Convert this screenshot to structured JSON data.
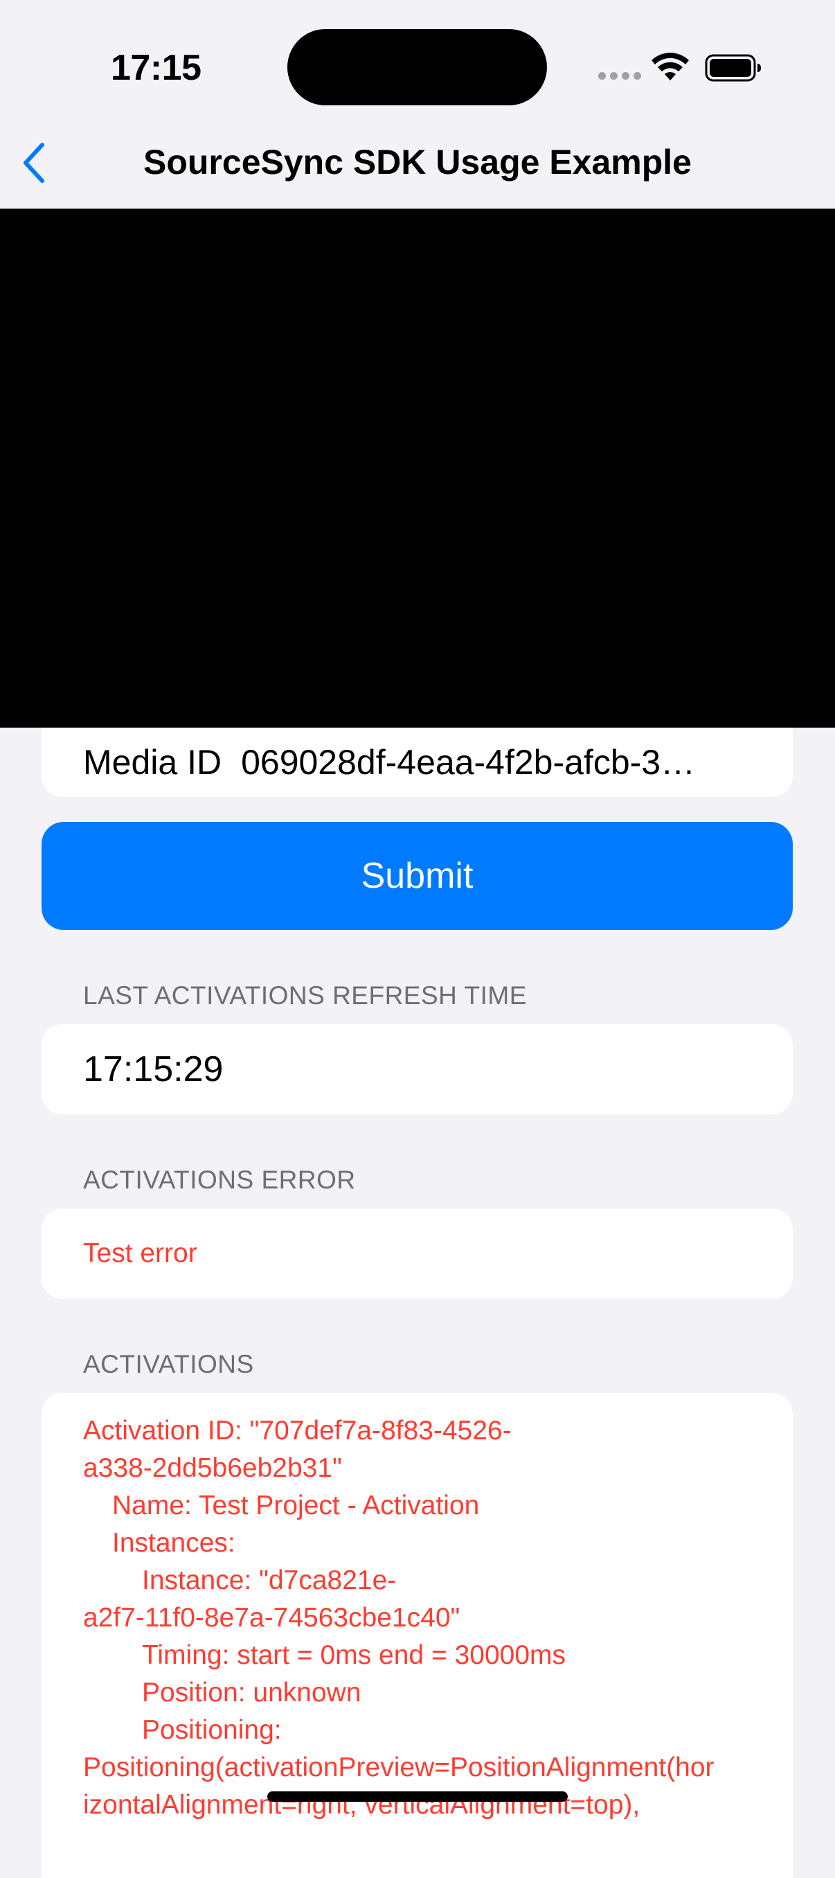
{
  "status_bar": {
    "time": "17:15",
    "icons": [
      "cellular-signal-icon",
      "wifi-icon",
      "battery-icon"
    ]
  },
  "nav": {
    "back_icon": "chevron-left-icon",
    "title": "SourceSync SDK Usage Example",
    "accent_color": "#007aff"
  },
  "media": {
    "label": "Media ID",
    "value": "069028df-4eaa-4f2b-afcb-3…"
  },
  "submit": {
    "label": "Submit"
  },
  "sections": {
    "refresh_header": "LAST ACTIVATIONS REFRESH TIME",
    "refresh_time": "17:15:29",
    "error_header": "ACTIVATIONS ERROR",
    "error_text": "Test error",
    "activations_header": "ACTIVATIONS"
  },
  "activations": {
    "lines": [
      "Activation ID: \"707def7a-8f83-4526-",
      "a338-2dd5b6eb2b31\"",
      "Name: Test Project - Activation",
      "Instances:",
      "Instance: \"d7ca821e-",
      "a2f7-11f0-8e7a-74563cbe1c40\"",
      "Timing: start = 0ms end = 30000ms",
      "Position: unknown",
      "Positioning:",
      "Positioning(activationPreview=PositionAlignment(hor",
      "izontalAlignment=right, verticalAlignment=top),"
    ]
  },
  "colors": {
    "background": "#f2f2f7",
    "error": "#ff3b30",
    "secondary_text": "#6d6d72"
  }
}
